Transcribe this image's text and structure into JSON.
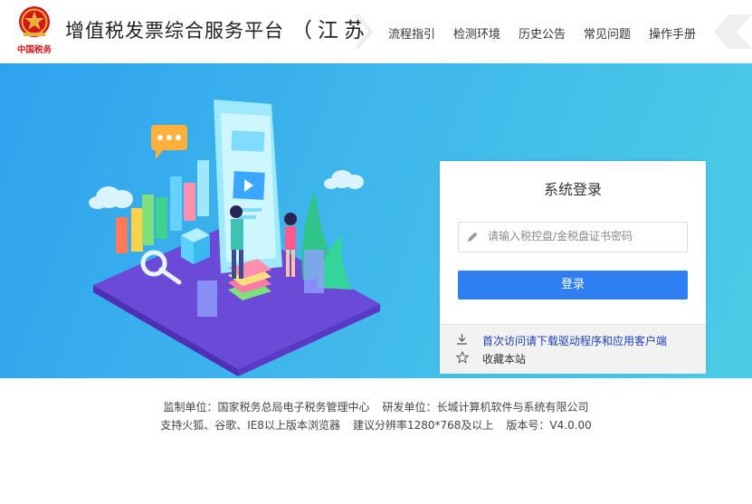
{
  "header": {
    "logo_text": "中国税务",
    "title": "增值税发票综合服务平台",
    "region": "（江苏）",
    "nav": [
      "流程指引",
      "检测环境",
      "历史公告",
      "常见问题",
      "操作手册"
    ]
  },
  "login": {
    "title": "系统登录",
    "password_placeholder": "请输入税控盘/金税盘证书密码",
    "password_value": "",
    "submit_label": "登录",
    "links": [
      {
        "label": "首次访问请下载驱动程序和应用客户端",
        "icon": "download-icon"
      },
      {
        "label": "收藏本站",
        "icon": "star-icon"
      }
    ]
  },
  "footer": {
    "line1": [
      "监制单位：国家税务总局电子税务管理中心",
      "研发单位：长城计算机软件与系统有限公司"
    ],
    "line2": [
      "支持火狐、谷歌、IE8以上版本浏览器",
      "建议分辨率1280*768及以上",
      "版本号：V4.0.00"
    ]
  },
  "colors": {
    "accent": "#2e7ff1",
    "link": "#1a3fb8",
    "hero_start": "#2fa2ee",
    "hero_end": "#4ccde6",
    "emblem_red": "#d4161a",
    "emblem_gold": "#e8b23a"
  }
}
